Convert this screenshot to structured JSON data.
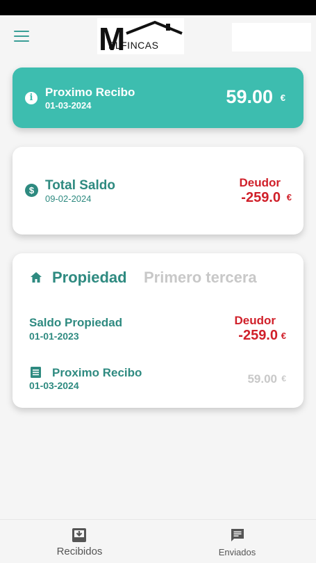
{
  "header": {
    "logo_first_letter": "M",
    "logo_text": "ELFINCAS",
    "menu_icon": "hamburger-menu-icon"
  },
  "next_receipt": {
    "title": "Proximo Recibo",
    "date": "01-03-2024",
    "amount": "59.00",
    "currency": "€",
    "icon": "info-icon"
  },
  "balance": {
    "title": "Total Saldo",
    "date": "09-02-2024",
    "status": "Deudor",
    "amount": "-259.0",
    "currency": "€",
    "icon": "dollar-icon"
  },
  "property": {
    "tabs": [
      {
        "label": "Propiedad",
        "active": true
      },
      {
        "label": "Primero tercera",
        "active": false
      }
    ],
    "balance_label": "Saldo Propiedad",
    "balance_date": "01-01-2023",
    "balance_status": "Deudor",
    "balance_amount": "-259.0",
    "balance_currency": "€",
    "next_label": "Proximo Recibo",
    "next_date": "01-03-2024",
    "next_amount": "59.00",
    "next_currency": "€"
  },
  "bottom_nav": {
    "items": [
      {
        "label": "Recibidos",
        "icon": "inbox-download-icon"
      },
      {
        "label": "Enviados",
        "icon": "message-icon"
      }
    ]
  },
  "colors": {
    "teal": "#3dbdaf",
    "teal_dark": "#2e8a80",
    "debt_red": "#d0202a",
    "muted": "#c8c8c8"
  }
}
